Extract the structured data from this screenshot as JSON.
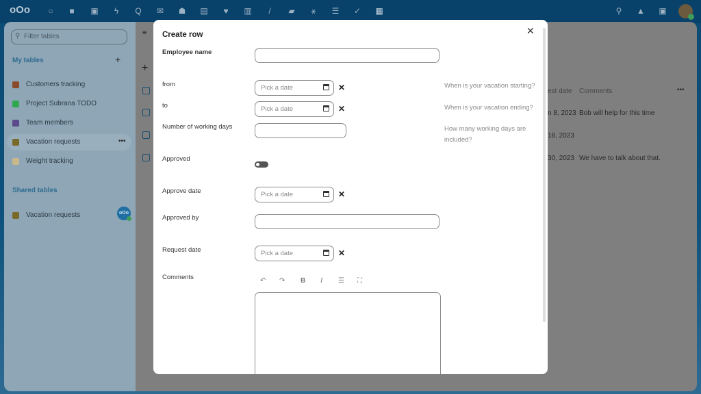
{
  "topbar": {
    "icons": [
      "nextcloud-logo",
      "dashboard-icon",
      "files-icon",
      "photos-icon",
      "activity-icon",
      "talk-icon",
      "mail-icon",
      "contacts-icon",
      "calendar-icon",
      "favorites-icon",
      "analytics-icon",
      "notes-icon",
      "deck-icon",
      "cospend-icon",
      "tasks-icon",
      "checklist-icon",
      "tables-icon"
    ],
    "right_icons": [
      "search-icon",
      "notifications-icon",
      "contacts-menu-icon",
      "avatar"
    ]
  },
  "sidebar": {
    "filter_placeholder": "Filter tables",
    "my_tables_label": "My tables",
    "my_tables": [
      {
        "label": "Customers tracking",
        "color": "#8a4b2a"
      },
      {
        "label": "Project Subrana TODO",
        "color": "#2fa84f"
      },
      {
        "label": "Team members",
        "color": "#5b4b8a"
      },
      {
        "label": "Vacation requests",
        "color": "#7a6a2a"
      },
      {
        "label": "Weight tracking",
        "color": "#c9b98a"
      }
    ],
    "shared_tables_label": "Shared tables",
    "shared_tables": [
      {
        "label": "Vacation requests"
      }
    ]
  },
  "table": {
    "col_request_date": "est date",
    "col_comments": "Comments",
    "rows": [
      {
        "date": "n 8, 2023",
        "comment": "Bob will help for this time"
      },
      {
        "date": "18, 2023",
        "comment": ""
      },
      {
        "date": "30, 2023",
        "comment": "We have to talk about that."
      }
    ]
  },
  "modal": {
    "title": "Create row",
    "fields": {
      "employee_name": "Employee name",
      "from": "from",
      "to": "to",
      "working_days": "Number of working days",
      "approved": "Approved",
      "approve_date": "Approve date",
      "approved_by": "Approved by",
      "request_date": "Request date",
      "comments": "Comments"
    },
    "date_placeholder": "Pick a date",
    "hints": {
      "from": "When is your vacation starting?",
      "to": "When is your vacation ending?",
      "working_days": "How many working days are included?"
    },
    "approved_value": false,
    "editor_toolbar": [
      "undo-icon",
      "redo-icon",
      "bold-icon",
      "italic-icon",
      "list-icon",
      "fullscreen-icon"
    ]
  }
}
